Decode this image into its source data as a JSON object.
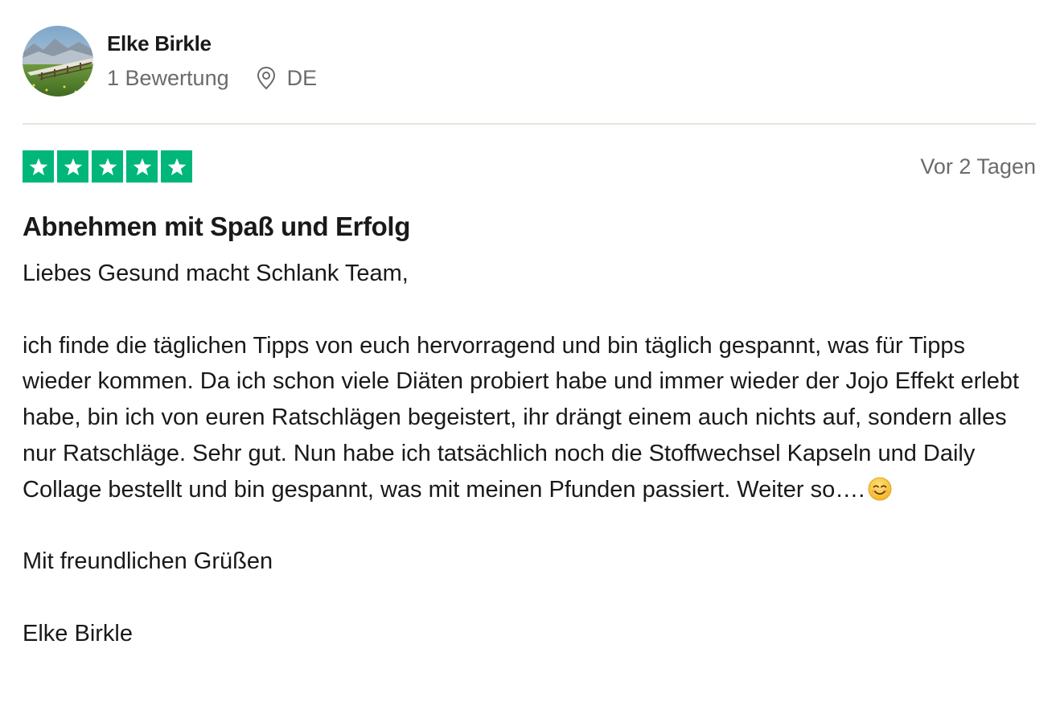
{
  "consumer": {
    "name": "Elke Birkle",
    "review_count": "1 Bewertung",
    "location": "DE",
    "avatar_icon": "landscape-photo-avatar",
    "location_icon": "map-pin-icon"
  },
  "review": {
    "rating": 5,
    "rating_max": 5,
    "star_color": "#00b67a",
    "date": "Vor 2 Tagen",
    "title": "Abnehmen mit Spaß und Erfolg",
    "greeting": "Liebes Gesund macht Schlank Team,",
    "body": "ich finde die täglichen Tipps von euch hervorragend und bin täglich gespannt, was für Tipps wieder kommen. Da ich schon viele Diäten probiert habe und immer wieder der Jojo Effekt erlebt habe, bin ich von euren Ratschlägen begeistert, ihr drängt einem auch nichts auf, sondern alles nur Ratschläge. Sehr gut. Nun habe ich tatsächlich noch die Stoffwechsel Kapseln und Daily Collage bestellt und bin gespannt, was mit meinen Pfunden passiert. Weiter so….",
    "body_emoji_icon": "smiling-face-emoji",
    "closing": "Mit freundlichen Grüßen",
    "signature": "Elke Birkle"
  }
}
